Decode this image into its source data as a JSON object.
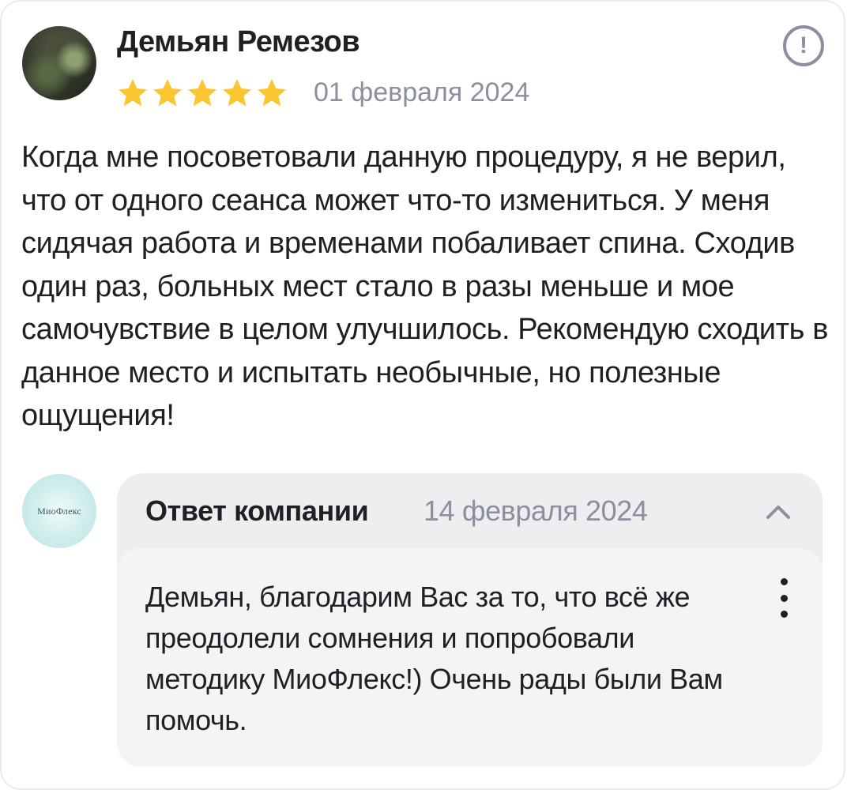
{
  "review": {
    "author_name": "Демьян Ремезов",
    "rating": 5,
    "rating_max": 5,
    "date": "01 февраля 2024",
    "text": "Когда мне посоветовали данную процедуру, я не верил, что от одного сеанса может что-то измениться. У меня сидячая работа и временами побаливает спина. Сходив один раз, больных мест стало в разы меньше и мое самочувствие в целом улучшилось. Рекомендую сходить в данное место и испытать необычные, но полезные ощущения!",
    "report_icon": "exclamation-circle-icon"
  },
  "company_reply": {
    "logo_text": "МиоФлекс",
    "title": "Ответ компании",
    "date": "14 февраля 2024",
    "text": "Демьян, благодарим Вас за то, что всё же преодолели сомнения и попробовали методику МиоФлекс!) Очень рады были Вам помочь.",
    "collapse_icon": "chevron-up-icon",
    "more_icon": "vertical-dots-icon"
  },
  "colors": {
    "star": "#fcc631",
    "muted_text": "#8b8f9e",
    "primary_text": "#1f1f24",
    "reply_background": "#eeeef0"
  }
}
